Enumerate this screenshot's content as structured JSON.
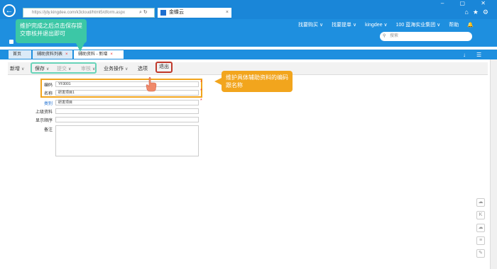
{
  "browser": {
    "address": "https://jdy.kingdee.com/k3cloud/html5/dform.aspx",
    "tab_title": "金蝶云"
  },
  "topnav": {
    "items": [
      "找要购买 ∨",
      "找要提单 ∨",
      "kingdee ∨",
      "100 蓝海实业集团 ∨",
      "帮助"
    ]
  },
  "search": {
    "placeholder": "搜索"
  },
  "app_tabs": [
    {
      "label": "首页"
    },
    {
      "label": "辅助资料列表"
    },
    {
      "label": "辅助资料 - 新增"
    }
  ],
  "toolbar": {
    "new_label": "新增",
    "save_label": "保存",
    "submit_label": "提交",
    "audit_label": "审核",
    "business_label": "业务操作",
    "options_label": "选项",
    "exit_label": "退出"
  },
  "form": {
    "code_label": "编码",
    "code_value": "YF3001",
    "name_label": "名称",
    "name_value": "研发项目1",
    "category_label": "类别",
    "category_value": "研发项目",
    "parent_label": "上级资料",
    "order_label": "显示顺序",
    "remark_label": "备注"
  },
  "callouts": {
    "green": "维护完成之后点击保存提交审核并退出即可",
    "orange": "维护具体辅助资料的编码跟名称"
  },
  "colors": {
    "header_blue": "#1e8fdf",
    "callout_green": "#3cc7a6",
    "callout_orange": "#f2a51d",
    "exit_border": "#c0392b"
  }
}
